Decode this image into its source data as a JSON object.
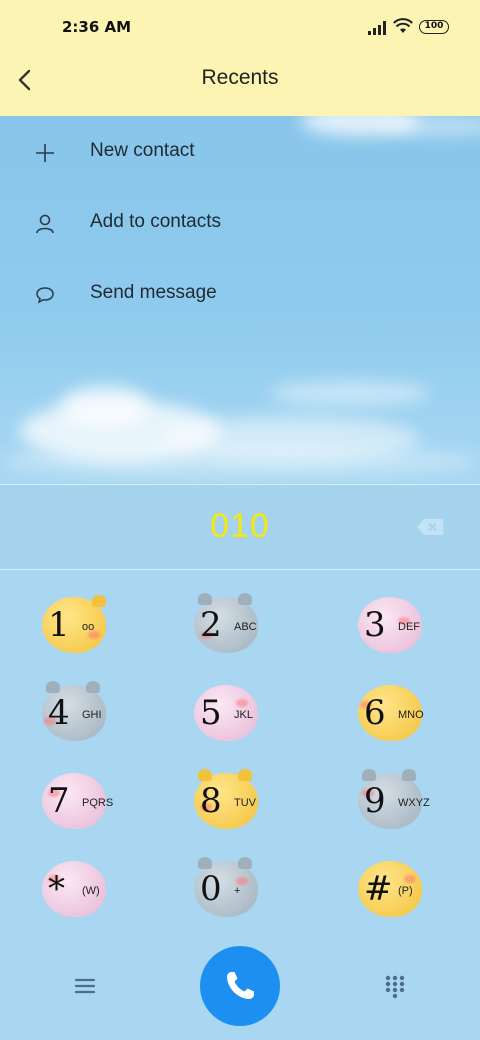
{
  "status_bar": {
    "time": "2:36 AM",
    "battery": "100"
  },
  "header": {
    "title": "Recents",
    "back_icon": "chevron-left-icon"
  },
  "actions": [
    {
      "label": "New contact",
      "icon": "plus-icon"
    },
    {
      "label": "Add to contacts",
      "icon": "person-icon"
    },
    {
      "label": "Send message",
      "icon": "chat-bubble-icon"
    }
  ],
  "dial": {
    "number": "010",
    "number_color": "#f5e80c"
  },
  "keypad": {
    "keys": [
      {
        "digit": "1",
        "letters": "oo"
      },
      {
        "digit": "2",
        "letters": "ABC"
      },
      {
        "digit": "3",
        "letters": "DEF"
      },
      {
        "digit": "4",
        "letters": "GHI"
      },
      {
        "digit": "5",
        "letters": "JKL"
      },
      {
        "digit": "6",
        "letters": "MNO"
      },
      {
        "digit": "7",
        "letters": "PQRS"
      },
      {
        "digit": "8",
        "letters": "TUV"
      },
      {
        "digit": "9",
        "letters": "WXYZ"
      },
      {
        "digit": "*",
        "letters": "(W)"
      },
      {
        "digit": "0",
        "letters": "+"
      },
      {
        "digit": "#",
        "letters": "(P)"
      }
    ]
  },
  "colors": {
    "header_bg": "#fbf4b3",
    "call_button": "#1d8ff0",
    "keypad_bg": "#a9d6f0",
    "blob_yellow": "#f6cf4a",
    "blob_gray": "#aab7c2",
    "blob_pink": "#efc6df"
  }
}
